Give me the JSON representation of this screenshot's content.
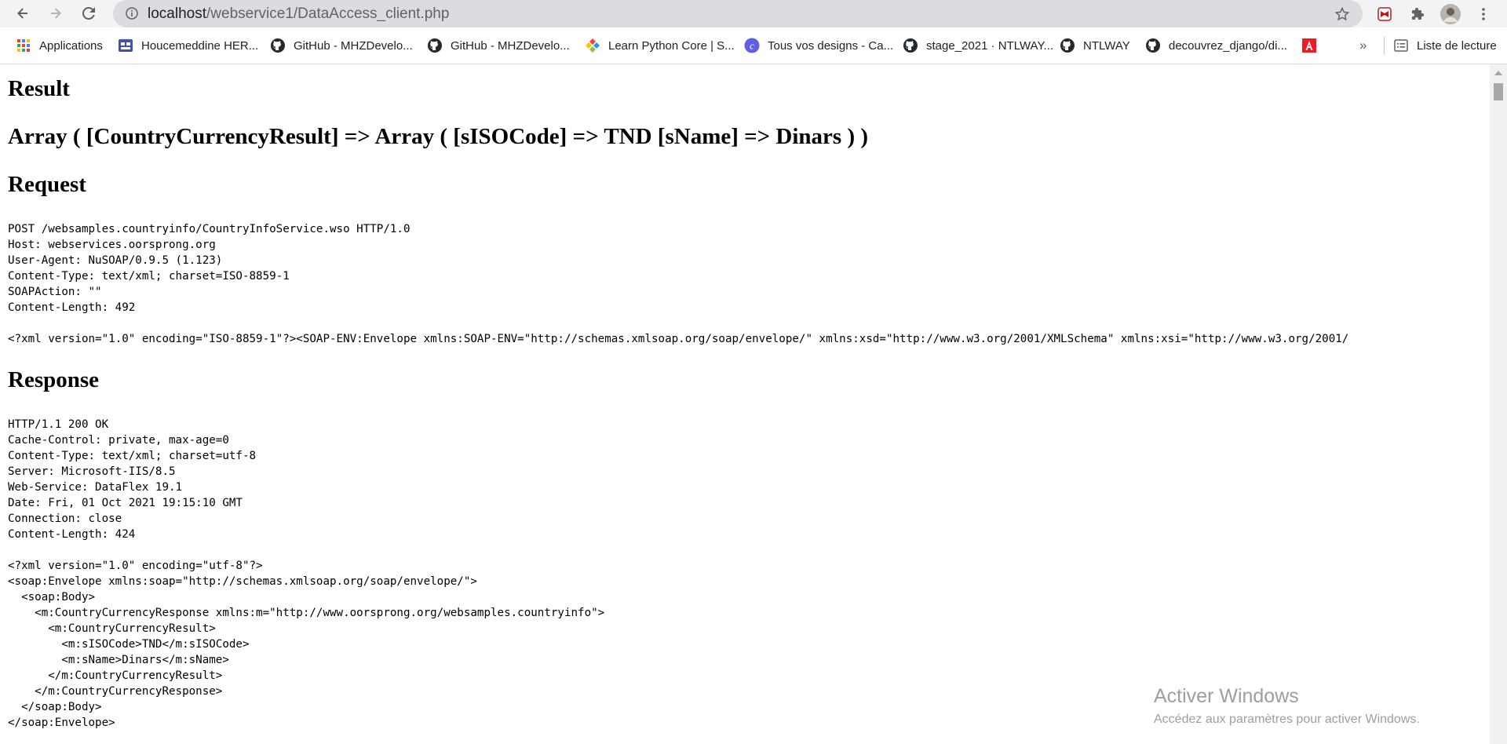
{
  "browser": {
    "url_host": "localhost",
    "url_path": "/webservice1/DataAccess_client.php",
    "bookmarks": [
      {
        "label": "Applications",
        "icon": "apps-grid-icon"
      },
      {
        "label": "Houcemeddine HER...",
        "icon": "bookmark-page-icon"
      },
      {
        "label": "GitHub - MHZDevelo...",
        "icon": "github-icon"
      },
      {
        "label": "GitHub - MHZDevelo...",
        "icon": "github-icon"
      },
      {
        "label": "Learn Python Core | S...",
        "icon": "sololearn-icon"
      },
      {
        "label": "Tous vos designs - Ca...",
        "icon": "canva-icon"
      },
      {
        "label": "stage_2021 · NTLWAY...",
        "icon": "github-icon"
      },
      {
        "label": "NTLWAY",
        "icon": "github-icon"
      },
      {
        "label": "decouvrez_django/di...",
        "icon": "github-icon"
      },
      {
        "label": "",
        "icon": "acrobat-icon"
      }
    ],
    "more_bookmarks": "»",
    "reading_list": "Liste de lecture"
  },
  "page": {
    "result_heading": "Result",
    "result_value": "Array ( [CountryCurrencyResult] => Array ( [sISOCode] => TND [sName] => Dinars ) )",
    "request_heading": "Request",
    "request_text": "POST /websamples.countryinfo/CountryInfoService.wso HTTP/1.0\nHost: webservices.oorsprong.org\nUser-Agent: NuSOAP/0.9.5 (1.123)\nContent-Type: text/xml; charset=ISO-8859-1\nSOAPAction: \"\"\nContent-Length: 492\n\n<?xml version=\"1.0\" encoding=\"ISO-8859-1\"?><SOAP-ENV:Envelope xmlns:SOAP-ENV=\"http://schemas.xmlsoap.org/soap/envelope/\" xmlns:xsd=\"http://www.w3.org/2001/XMLSchema\" xmlns:xsi=\"http://www.w3.org/2001/",
    "response_heading": "Response",
    "response_text": "HTTP/1.1 200 OK\nCache-Control: private, max-age=0\nContent-Type: text/xml; charset=utf-8\nServer: Microsoft-IIS/8.5\nWeb-Service: DataFlex 19.1\nDate: Fri, 01 Oct 2021 19:15:10 GMT\nConnection: close\nContent-Length: 424\n\n<?xml version=\"1.0\" encoding=\"utf-8\"?>\n<soap:Envelope xmlns:soap=\"http://schemas.xmlsoap.org/soap/envelope/\">\n  <soap:Body>\n    <m:CountryCurrencyResponse xmlns:m=\"http://www.oorsprong.org/websamples.countryinfo\">\n      <m:CountryCurrencyResult>\n        <m:sISOCode>TND</m:sISOCode>\n        <m:sName>Dinars</m:sName>\n      </m:CountryCurrencyResult>\n    </m:CountryCurrencyResponse>\n  </soap:Body>\n</soap:Envelope>"
  },
  "watermark": {
    "line1": "Activer Windows",
    "line2": "Accédez aux paramètres pour activer Windows."
  }
}
